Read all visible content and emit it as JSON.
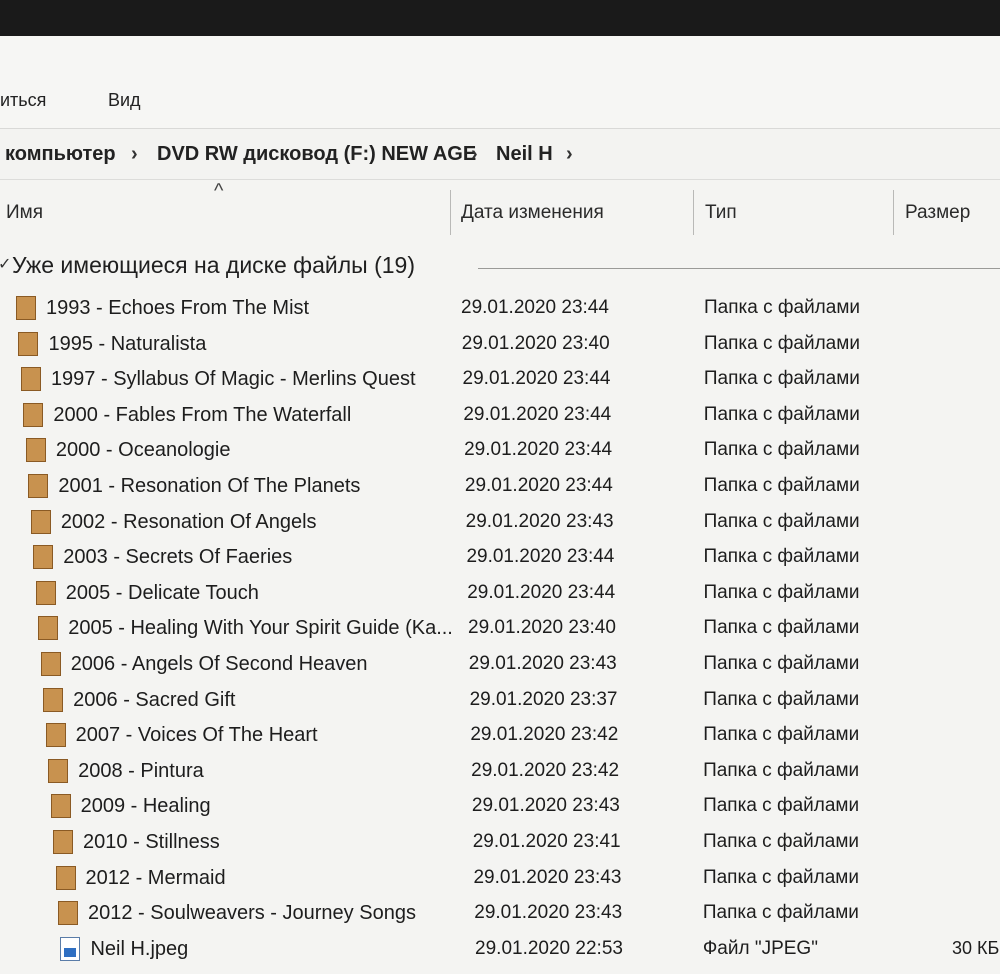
{
  "ribbon": {
    "tabs": [
      "иться",
      "Вид"
    ]
  },
  "address_bar": {
    "crumbs": [
      "компьютер",
      "DVD RW дисковод (F:) NEW AGE",
      "Neil H"
    ],
    "separator": "›"
  },
  "columns": {
    "name": "Имя",
    "date": "Дата изменения",
    "type": "Тип",
    "size": "Размер",
    "sort_indicator": "^"
  },
  "group": {
    "title": "Уже имеющиеся на диске файлы (19)",
    "chevron": "✓"
  },
  "colors": {
    "folder": "#c8924f",
    "background": "#f4f4f2"
  },
  "files": [
    {
      "name": "1993 - Echoes From The Mist",
      "date": "29.01.2020 23:44",
      "type": "Папка с файлами",
      "size": "",
      "icon": "folder-icon"
    },
    {
      "name": "1995 - Naturalista",
      "date": "29.01.2020 23:40",
      "type": "Папка с файлами",
      "size": "",
      "icon": "folder-icon"
    },
    {
      "name": "1997 - Syllabus Of Magic - Merlins Quest",
      "date": "29.01.2020 23:44",
      "type": "Папка с файлами",
      "size": "",
      "icon": "folder-icon"
    },
    {
      "name": "2000 - Fables From The Waterfall",
      "date": "29.01.2020 23:44",
      "type": "Папка с файлами",
      "size": "",
      "icon": "folder-icon"
    },
    {
      "name": "2000 - Oceanologie",
      "date": "29.01.2020 23:44",
      "type": "Папка с файлами",
      "size": "",
      "icon": "folder-icon"
    },
    {
      "name": "2001 - Resonation Of The Planets",
      "date": "29.01.2020 23:44",
      "type": "Папка с файлами",
      "size": "",
      "icon": "folder-icon"
    },
    {
      "name": "2002 - Resonation Of Angels",
      "date": "29.01.2020 23:43",
      "type": "Папка с файлами",
      "size": "",
      "icon": "folder-icon"
    },
    {
      "name": "2003 - Secrets Of Faeries",
      "date": "29.01.2020 23:44",
      "type": "Папка с файлами",
      "size": "",
      "icon": "folder-icon"
    },
    {
      "name": "2005 - Delicate Touch",
      "date": "29.01.2020 23:44",
      "type": "Папка с файлами",
      "size": "",
      "icon": "folder-icon"
    },
    {
      "name": "2005 - Healing With Your Spirit Guide (Ka...",
      "date": "29.01.2020 23:40",
      "type": "Папка с файлами",
      "size": "",
      "icon": "folder-icon"
    },
    {
      "name": "2006 - Angels Of Second Heaven",
      "date": "29.01.2020 23:43",
      "type": "Папка с файлами",
      "size": "",
      "icon": "folder-icon"
    },
    {
      "name": "2006 - Sacred Gift",
      "date": "29.01.2020 23:37",
      "type": "Папка с файлами",
      "size": "",
      "icon": "folder-icon"
    },
    {
      "name": "2007 - Voices Of The Heart",
      "date": "29.01.2020 23:42",
      "type": "Папка с файлами",
      "size": "",
      "icon": "folder-icon"
    },
    {
      "name": "2008 - Pintura",
      "date": "29.01.2020 23:42",
      "type": "Папка с файлами",
      "size": "",
      "icon": "folder-icon"
    },
    {
      "name": "2009 - Healing",
      "date": "29.01.2020 23:43",
      "type": "Папка с файлами",
      "size": "",
      "icon": "folder-icon"
    },
    {
      "name": "2010 - Stillness",
      "date": "29.01.2020 23:41",
      "type": "Папка с файлами",
      "size": "",
      "icon": "folder-icon"
    },
    {
      "name": "2012 - Mermaid",
      "date": "29.01.2020 23:43",
      "type": "Папка с файлами",
      "size": "",
      "icon": "folder-icon"
    },
    {
      "name": "2012 - Soulweavers - Journey Songs",
      "date": "29.01.2020 23:43",
      "type": "Папка с файлами",
      "size": "",
      "icon": "folder-icon"
    },
    {
      "name": "Neil H.jpeg",
      "date": "29.01.2020 22:53",
      "type": "Файл \"JPEG\"",
      "size": "30 КБ",
      "icon": "image-file-icon"
    }
  ]
}
